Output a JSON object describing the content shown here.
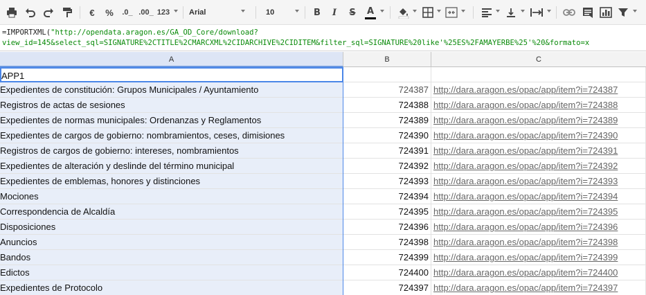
{
  "toolbar": {
    "currency_label": "€",
    "percent_label": "%",
    "dec_decrease_label": ".0_",
    "dec_increase_label": ".00_",
    "more_formats_label": "123",
    "font_family": "Arial",
    "font_size": "10",
    "bold_label": "B",
    "italic_label": "I",
    "strike_label": "S",
    "text_color_label": "A"
  },
  "formula_bar": {
    "fn": "=IMPORTXML(",
    "line1": "\"http://opendata.aragon.es/GA_OD_Core/download?",
    "line2": "view_id=145&select_sql=SIGNATURE%2CTITLE%2CMARCXML%2CIDARCHIVE%2CIDITEM&filter_sql=SIGNATURE%20like'%25ES%2FAMAYERBE%25'%20&formato=x"
  },
  "columns": [
    "A",
    "B",
    "C"
  ],
  "rows": [
    {
      "a": "APP1",
      "b": "",
      "c": ""
    },
    {
      "a": "Expedientes de constitución: Grupos Municipales / Ayuntamiento",
      "b": "724387",
      "c": "http://dara.aragon.es/opac/app/item?i=724387"
    },
    {
      "a": "Registros de actas de sesiones",
      "b": "724388",
      "c": "http://dara.aragon.es/opac/app/item?i=724388"
    },
    {
      "a": "Expedientes de normas municipales: Ordenanzas y Reglamentos",
      "b": "724389",
      "c": "http://dara.aragon.es/opac/app/item?i=724389"
    },
    {
      "a": "Expedientes de cargos de gobierno: nombramientos, ceses, dimisiones",
      "b": "724390",
      "c": "http://dara.aragon.es/opac/app/item?i=724390"
    },
    {
      "a": "Registros de cargos de gobierno: intereses, nombramientos",
      "b": "724391",
      "c": "http://dara.aragon.es/opac/app/item?i=724391"
    },
    {
      "a": "Expedientes de alteración y deslinde del término municipal",
      "b": "724392",
      "c": "http://dara.aragon.es/opac/app/item?i=724392"
    },
    {
      "a": "Expedientes de emblemas, honores y distinciones",
      "b": "724393",
      "c": "http://dara.aragon.es/opac/app/item?i=724393"
    },
    {
      "a": "Mociones",
      "b": "724394",
      "c": "http://dara.aragon.es/opac/app/item?i=724394"
    },
    {
      "a": "Correspondencia de Alcaldía",
      "b": "724395",
      "c": "http://dara.aragon.es/opac/app/item?i=724395"
    },
    {
      "a": "Disposiciones",
      "b": "724396",
      "c": "http://dara.aragon.es/opac/app/item?i=724396"
    },
    {
      "a": "Anuncios",
      "b": "724398",
      "c": "http://dara.aragon.es/opac/app/item?i=724398"
    },
    {
      "a": "Bandos",
      "b": "724399",
      "c": "http://dara.aragon.es/opac/app/item?i=724399"
    },
    {
      "a": "Edictos",
      "b": "724400",
      "c": "http://dara.aragon.es/opac/app/item?i=724400"
    },
    {
      "a": "Expedientes de Protocolo",
      "b": "724397",
      "c": "http://dara.aragon.es/opac/app/item?i=724397"
    }
  ]
}
